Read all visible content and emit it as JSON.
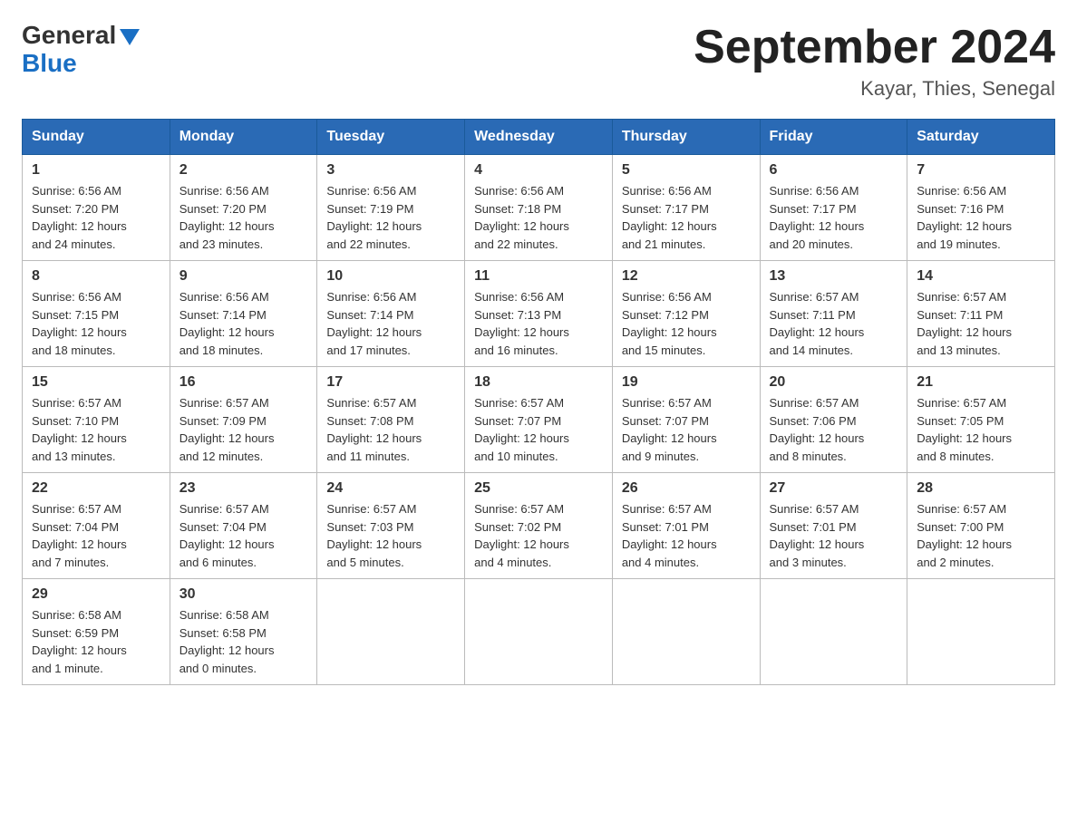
{
  "header": {
    "logo_general": "General",
    "logo_blue": "Blue",
    "month_title": "September 2024",
    "location": "Kayar, Thies, Senegal"
  },
  "weekdays": [
    "Sunday",
    "Monday",
    "Tuesday",
    "Wednesday",
    "Thursday",
    "Friday",
    "Saturday"
  ],
  "weeks": [
    [
      {
        "day": "1",
        "sunrise": "6:56 AM",
        "sunset": "7:20 PM",
        "daylight": "12 hours and 24 minutes."
      },
      {
        "day": "2",
        "sunrise": "6:56 AM",
        "sunset": "7:20 PM",
        "daylight": "12 hours and 23 minutes."
      },
      {
        "day": "3",
        "sunrise": "6:56 AM",
        "sunset": "7:19 PM",
        "daylight": "12 hours and 22 minutes."
      },
      {
        "day": "4",
        "sunrise": "6:56 AM",
        "sunset": "7:18 PM",
        "daylight": "12 hours and 22 minutes."
      },
      {
        "day": "5",
        "sunrise": "6:56 AM",
        "sunset": "7:17 PM",
        "daylight": "12 hours and 21 minutes."
      },
      {
        "day": "6",
        "sunrise": "6:56 AM",
        "sunset": "7:17 PM",
        "daylight": "12 hours and 20 minutes."
      },
      {
        "day": "7",
        "sunrise": "6:56 AM",
        "sunset": "7:16 PM",
        "daylight": "12 hours and 19 minutes."
      }
    ],
    [
      {
        "day": "8",
        "sunrise": "6:56 AM",
        "sunset": "7:15 PM",
        "daylight": "12 hours and 18 minutes."
      },
      {
        "day": "9",
        "sunrise": "6:56 AM",
        "sunset": "7:14 PM",
        "daylight": "12 hours and 18 minutes."
      },
      {
        "day": "10",
        "sunrise": "6:56 AM",
        "sunset": "7:14 PM",
        "daylight": "12 hours and 17 minutes."
      },
      {
        "day": "11",
        "sunrise": "6:56 AM",
        "sunset": "7:13 PM",
        "daylight": "12 hours and 16 minutes."
      },
      {
        "day": "12",
        "sunrise": "6:56 AM",
        "sunset": "7:12 PM",
        "daylight": "12 hours and 15 minutes."
      },
      {
        "day": "13",
        "sunrise": "6:57 AM",
        "sunset": "7:11 PM",
        "daylight": "12 hours and 14 minutes."
      },
      {
        "day": "14",
        "sunrise": "6:57 AM",
        "sunset": "7:11 PM",
        "daylight": "12 hours and 13 minutes."
      }
    ],
    [
      {
        "day": "15",
        "sunrise": "6:57 AM",
        "sunset": "7:10 PM",
        "daylight": "12 hours and 13 minutes."
      },
      {
        "day": "16",
        "sunrise": "6:57 AM",
        "sunset": "7:09 PM",
        "daylight": "12 hours and 12 minutes."
      },
      {
        "day": "17",
        "sunrise": "6:57 AM",
        "sunset": "7:08 PM",
        "daylight": "12 hours and 11 minutes."
      },
      {
        "day": "18",
        "sunrise": "6:57 AM",
        "sunset": "7:07 PM",
        "daylight": "12 hours and 10 minutes."
      },
      {
        "day": "19",
        "sunrise": "6:57 AM",
        "sunset": "7:07 PM",
        "daylight": "12 hours and 9 minutes."
      },
      {
        "day": "20",
        "sunrise": "6:57 AM",
        "sunset": "7:06 PM",
        "daylight": "12 hours and 8 minutes."
      },
      {
        "day": "21",
        "sunrise": "6:57 AM",
        "sunset": "7:05 PM",
        "daylight": "12 hours and 8 minutes."
      }
    ],
    [
      {
        "day": "22",
        "sunrise": "6:57 AM",
        "sunset": "7:04 PM",
        "daylight": "12 hours and 7 minutes."
      },
      {
        "day": "23",
        "sunrise": "6:57 AM",
        "sunset": "7:04 PM",
        "daylight": "12 hours and 6 minutes."
      },
      {
        "day": "24",
        "sunrise": "6:57 AM",
        "sunset": "7:03 PM",
        "daylight": "12 hours and 5 minutes."
      },
      {
        "day": "25",
        "sunrise": "6:57 AM",
        "sunset": "7:02 PM",
        "daylight": "12 hours and 4 minutes."
      },
      {
        "day": "26",
        "sunrise": "6:57 AM",
        "sunset": "7:01 PM",
        "daylight": "12 hours and 4 minutes."
      },
      {
        "day": "27",
        "sunrise": "6:57 AM",
        "sunset": "7:01 PM",
        "daylight": "12 hours and 3 minutes."
      },
      {
        "day": "28",
        "sunrise": "6:57 AM",
        "sunset": "7:00 PM",
        "daylight": "12 hours and 2 minutes."
      }
    ],
    [
      {
        "day": "29",
        "sunrise": "6:58 AM",
        "sunset": "6:59 PM",
        "daylight": "12 hours and 1 minute."
      },
      {
        "day": "30",
        "sunrise": "6:58 AM",
        "sunset": "6:58 PM",
        "daylight": "12 hours and 0 minutes."
      },
      null,
      null,
      null,
      null,
      null
    ]
  ]
}
